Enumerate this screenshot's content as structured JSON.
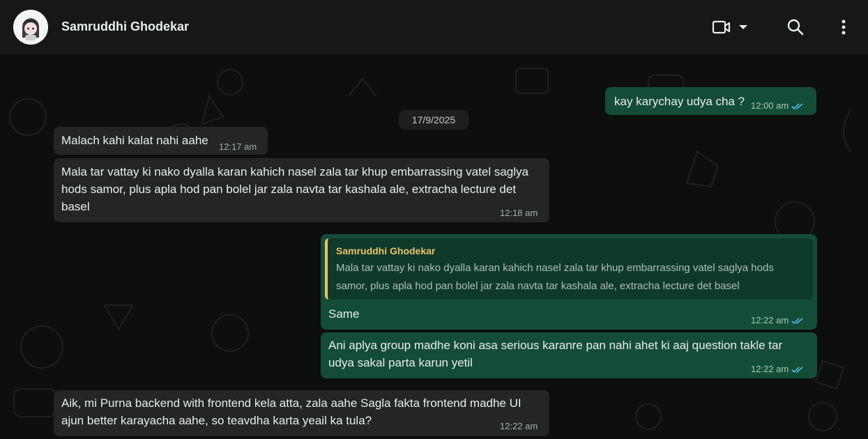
{
  "header": {
    "contact_name": "Samruddhi Ghodekar",
    "icons": [
      "avatar",
      "video-call-icon",
      "chevron-down-icon",
      "search-icon",
      "more-vertical-icon"
    ]
  },
  "chat": {
    "date_chip": "17/9/2025",
    "messages": [
      {
        "direction": "out",
        "text": "kay karychay udya cha ?",
        "time": "12:00 am",
        "status": "read"
      },
      {
        "direction": "in",
        "text": "Malach kahi kalat nahi aahe",
        "time": "12:17 am"
      },
      {
        "direction": "in",
        "text": "Mala tar vattay ki nako dyalla karan kahich nasel zala tar khup embarrassing vatel saglya hods samor, plus apla hod pan bolel jar zala navta tar kashala ale, extracha lecture det basel",
        "time": "12:18 am"
      },
      {
        "direction": "out",
        "quote_author": "Samruddhi Ghodekar",
        "quote_text": "Mala tar vattay ki nako dyalla karan kahich nasel zala tar khup embarrassing vatel saglya hods samor, plus apla hod pan bolel jar zala navta tar kashala ale, extracha lecture det basel",
        "text": "Same",
        "time": "12:22 am",
        "status": "read"
      },
      {
        "direction": "out",
        "text": "Ani aplya group madhe koni asa serious karanre pan nahi ahet ki aaj question takle tar udya sakal parta karun yetil",
        "time": "12:22 am",
        "status": "read"
      },
      {
        "direction": "in",
        "text": "Aik, mi Purna backend with frontend kela atta, zala aahe Sagla fakta frontend madhe UI ajun better karayacha aahe, so teavdha karta yeail ka tula?",
        "time": "12:22 am"
      }
    ]
  },
  "colors": {
    "header_bg": "#161717",
    "incoming_bubble": "#242626",
    "outgoing_bubble": "#144d37",
    "read_ticks": "#53bdeb",
    "quote_accent": "#e9c46a"
  }
}
